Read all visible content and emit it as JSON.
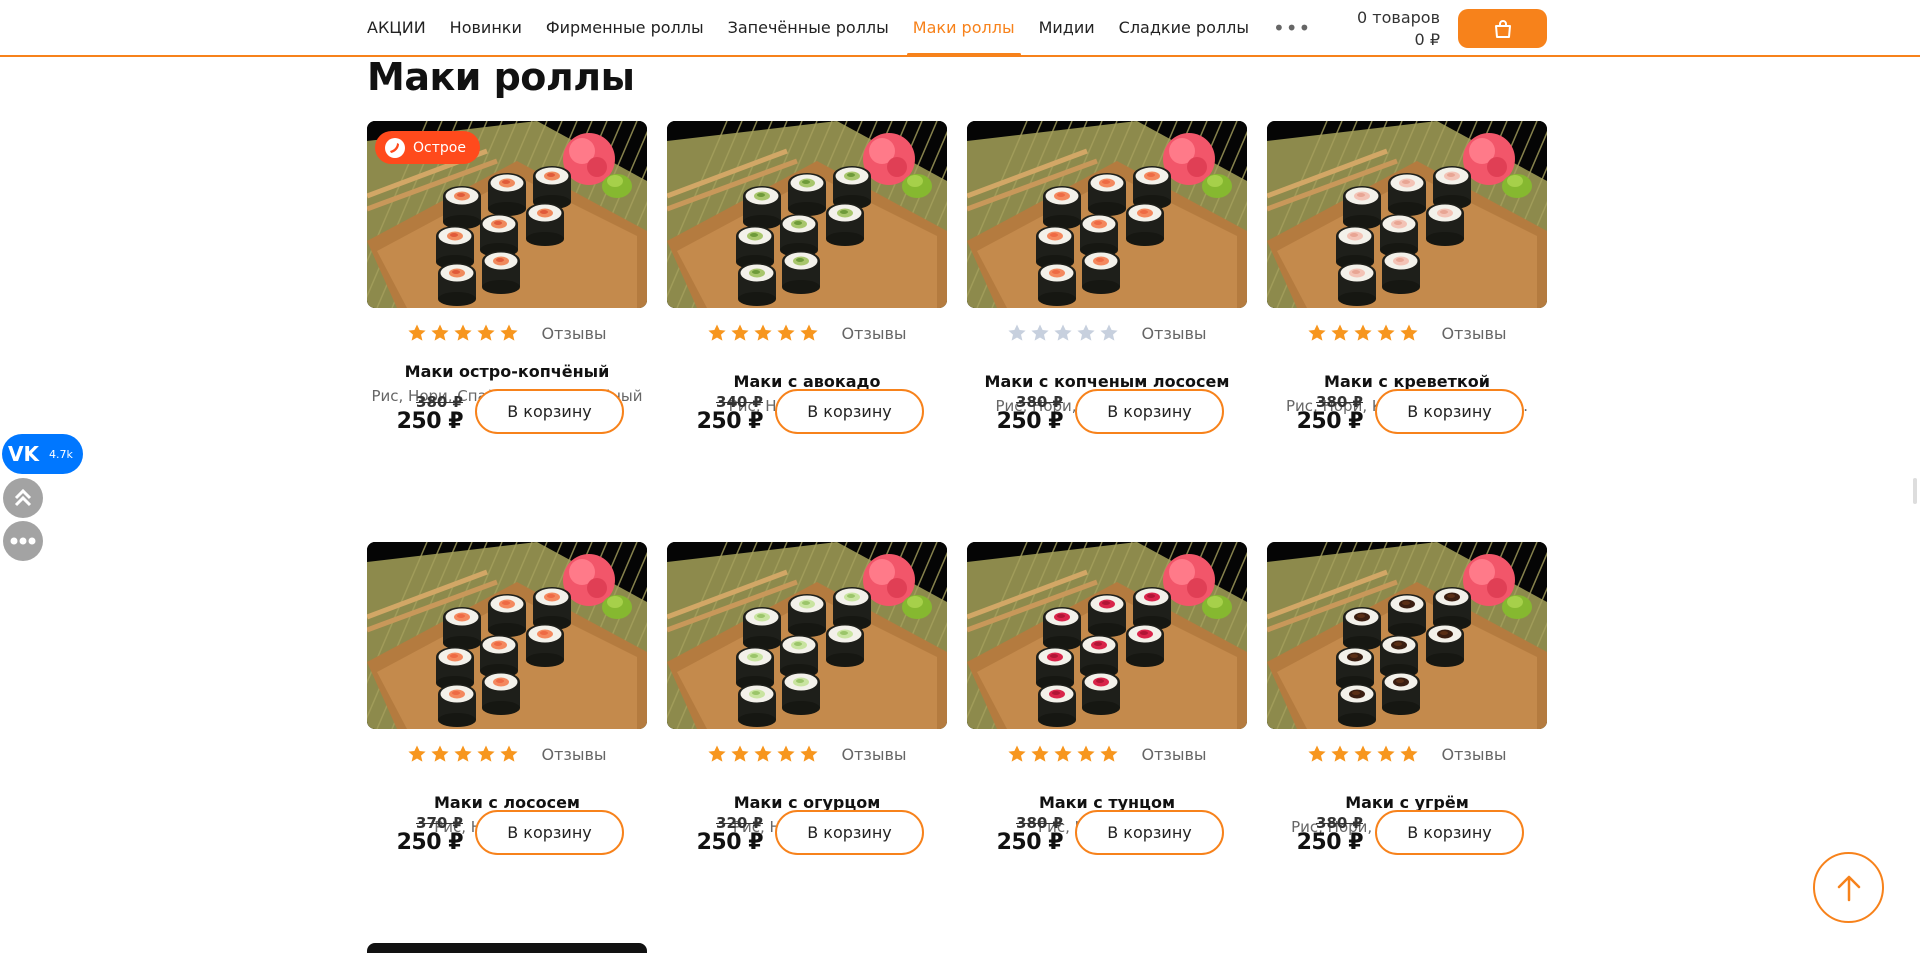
{
  "header": {
    "nav": [
      {
        "label": "АКЦИИ",
        "active": false
      },
      {
        "label": "Новинки",
        "active": false
      },
      {
        "label": "Фирменные роллы",
        "active": false
      },
      {
        "label": "Запечённые роллы",
        "active": false
      },
      {
        "label": "Маки роллы",
        "active": true
      },
      {
        "label": "Мидии",
        "active": false
      },
      {
        "label": "Сладкие роллы",
        "active": false
      }
    ],
    "more": "•••",
    "cart_count": "0 товаров",
    "cart_total": "0 ₽",
    "cart_icon": "shopping-bag-icon"
  },
  "page": {
    "title": "Маки роллы"
  },
  "products": [
    {
      "name": "Маки остро-копчёный",
      "desc": "Рис, Нори, Спайси соус, Копчёный лосось.",
      "old_price": "380 ₽",
      "price": "250 ₽",
      "rating": 5,
      "reviews": "Отзывы",
      "button": "В корзину",
      "badge": "Острое",
      "filling": "salmon-spicy"
    },
    {
      "name": "Маки с авокадо",
      "desc": "Рис, Нори, Авокадо.",
      "old_price": "340 ₽",
      "price": "250 ₽",
      "rating": 5,
      "reviews": "Отзывы",
      "button": "В корзину",
      "badge": "",
      "filling": "avocado"
    },
    {
      "name": "Маки с копченым лососем",
      "desc": "Рис, Нори, Копченый лосось",
      "old_price": "380 ₽",
      "price": "250 ₽",
      "rating": 0,
      "reviews": "Отзывы",
      "button": "В корзину",
      "badge": "",
      "filling": "salmon"
    },
    {
      "name": "Маки с креветкой",
      "desc": "Рис, Нори, Креветка тигровая.",
      "old_price": "380 ₽",
      "price": "250 ₽",
      "rating": 5,
      "reviews": "Отзывы",
      "button": "В корзину",
      "badge": "",
      "filling": "shrimp"
    },
    {
      "name": "Маки с лососем",
      "desc": "Рис, Нори, Лосось.",
      "old_price": "370 ₽",
      "price": "250 ₽",
      "rating": 5,
      "reviews": "Отзывы",
      "button": "В корзину",
      "badge": "",
      "filling": "salmon"
    },
    {
      "name": "Маки с огурцом",
      "desc": "Рис, Нори, Огурец.",
      "old_price": "320 ₽",
      "price": "250 ₽",
      "rating": 5,
      "reviews": "Отзывы",
      "button": "В корзину",
      "badge": "",
      "filling": "cucumber"
    },
    {
      "name": "Маки с тунцом",
      "desc": "Рис, Нори, Тунец.",
      "old_price": "380 ₽",
      "price": "250 ₽",
      "rating": 5,
      "reviews": "Отзывы",
      "button": "В корзину",
      "badge": "",
      "filling": "tuna"
    },
    {
      "name": "Маки с угрём",
      "desc": "Рис, Нори, Соус унаги, Угорь.",
      "old_price": "380 ₽",
      "price": "250 ₽",
      "rating": 5,
      "reviews": "Отзывы",
      "button": "В корзину",
      "badge": "",
      "filling": "eel"
    }
  ],
  "side": {
    "vk_logo": "VK",
    "vk_count": "4.7k",
    "icons": [
      "double-chevron-up-icon",
      "more-dots-icon"
    ]
  },
  "scroll_top_icon": "arrow-up-icon",
  "colors": {
    "accent": "#f7821b",
    "star_on": "#f7961e",
    "star_off": "#c7d0de",
    "badge": "#ff4a1c",
    "vk": "#0077ff"
  }
}
